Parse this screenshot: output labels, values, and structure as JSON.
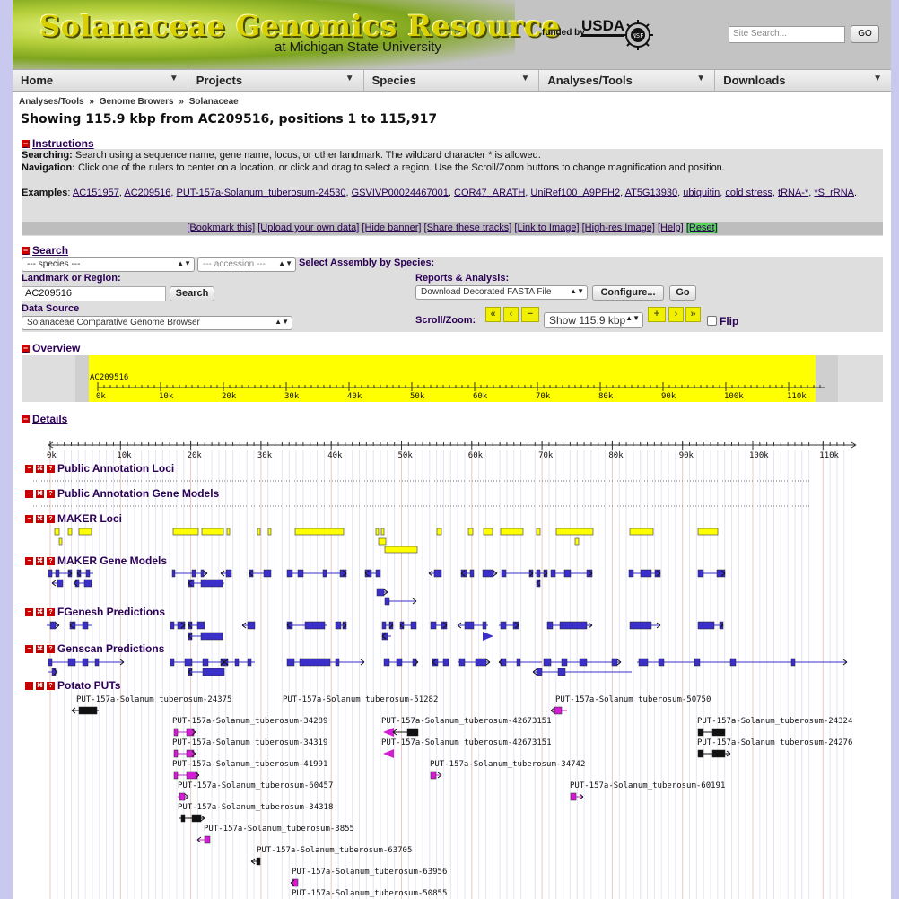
{
  "banner": {
    "title": "Solanaceae Genomics Resource",
    "subtitle": "at Michigan State University",
    "funded_by": "funded by",
    "usda": "USDA",
    "nsf": "NSF",
    "search_placeholder": "Site Search...",
    "go_label": "GO"
  },
  "nav": [
    {
      "label": "Home"
    },
    {
      "label": "Projects"
    },
    {
      "label": "Species"
    },
    {
      "label": "Analyses/Tools"
    },
    {
      "label": "Downloads"
    }
  ],
  "breadcrumb": {
    "items": [
      "Analyses/Tools",
      "Genome Browers",
      "Solanaceae"
    ],
    "separator": "»"
  },
  "heading": "Showing 115.9 kbp from AC209516, positions 1 to 115,917",
  "instructions": {
    "label": "Instructions",
    "searching_label": "Searching:",
    "searching_text": " Search using a sequence name, gene name, locus, or other landmark. The wildcard character * is allowed.",
    "navigation_label": "Navigation:",
    "navigation_text": " Click one of the rulers to center on a location, or click and drag to select a region. Use the Scroll/Zoom buttons to change magnification and position.",
    "examples_label": "Examples",
    "examples": [
      "AC151957",
      "AC209516",
      "PUT-157a-Solanum_tuberosum-24530",
      "GSVIVP00024467001",
      "COR47_ARATH",
      "UniRef100_A9PFH2",
      "AT5G13930",
      "ubiquitin",
      "cold stress",
      "tRNA-*",
      "*S_rRNA"
    ]
  },
  "link_bar": [
    "[Bookmark this]",
    "[Upload your own data]",
    "[Hide banner]",
    "[Share these tracks]",
    "[Link to Image]",
    "[High-res Image]",
    "[Help]",
    "[Reset]"
  ],
  "search": {
    "label": "Search",
    "species_select": "--- species ---",
    "accession_select": "--- accession ---",
    "select_assembly_label": "Select Assembly by Species:",
    "landmark_label": "Landmark or Region:",
    "landmark_value": "AC209516",
    "search_button": "Search",
    "data_source_label": "Data Source",
    "data_source_value": "Solanaceae Comparative Genome Browser",
    "reports_label": "Reports & Analysis:",
    "reports_value": "Download Decorated FASTA File",
    "configure_button": "Configure...",
    "go_button": "Go",
    "scroll_zoom_label": "Scroll/Zoom:",
    "zoom_value": "Show 115.9 kbp",
    "flip_label": "Flip",
    "zoom_icons": [
      "«",
      "‹",
      "−",
      "+",
      "›",
      "»"
    ]
  },
  "overview": {
    "label": "Overview",
    "landmark": "AC209516",
    "ticks": [
      "0k",
      "10k",
      "20k",
      "30k",
      "40k",
      "50k",
      "60k",
      "70k",
      "80k",
      "90k",
      "100k",
      "110k"
    ]
  },
  "details": {
    "label": "Details",
    "ticks": [
      "0k",
      "10k",
      "20k",
      "30k",
      "40k",
      "50k",
      "60k",
      "70k",
      "80k",
      "90k",
      "100k",
      "110k"
    ],
    "tracks": [
      {
        "name": "Public Annotation Loci"
      },
      {
        "name": "Public Annotation Gene Models"
      },
      {
        "name": "MAKER Loci"
      },
      {
        "name": "MAKER Gene Models"
      },
      {
        "name": "FGenesh Predictions"
      },
      {
        "name": "Genscan Predictions"
      },
      {
        "name": "Potato PUTs"
      }
    ],
    "track_icons": [
      "−",
      "⌘",
      "?"
    ],
    "puts": [
      "PUT-157a-Solanum_tuberosum-24375",
      "PUT-157a-Solanum_tuberosum-51282",
      "PUT-157a-Solanum_tuberosum-50750",
      "PUT-157a-Solanum_tuberosum-34289",
      "PUT-157a-Solanum_tuberosum-42673151",
      "PUT-157a-Solanum_tuberosum-24324",
      "PUT-157a-Solanum_tuberosum-34319",
      "PUT-157a-Solanum_tuberosum-42673151",
      "PUT-157a-Solanum_tuberosum-24276",
      "PUT-157a-Solanum_tuberosum-41991",
      "PUT-157a-Solanum_tuberosum-34742",
      "PUT-157a-Solanum_tuberosum-60457",
      "PUT-157a-Solanum_tuberosum-60191",
      "PUT-157a-Solanum_tuberosum-34318",
      "PUT-157a-Solanum_tuberosum-3855",
      "PUT-157a-Solanum_tuberosum-63705",
      "PUT-157a-Solanum_tuberosum-63956",
      "PUT-157a-Solanum_tuberosum-50855"
    ]
  },
  "colors": {
    "page_background": "#c9c9ef",
    "link": "#2b0055",
    "section_icon": "#cc0000",
    "maker_loci": "#ffff00",
    "gene_model": "#3a2fc8",
    "put": "#d21ed2"
  }
}
